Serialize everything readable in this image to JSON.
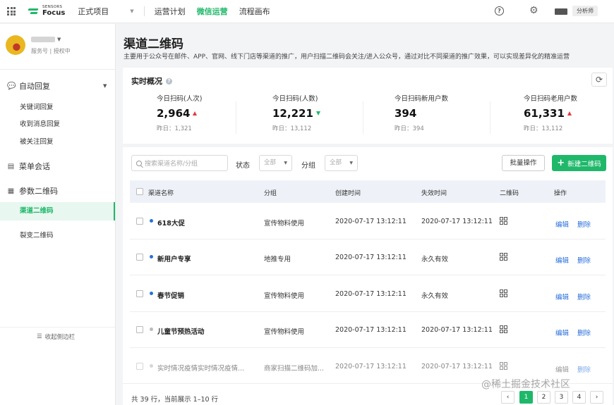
{
  "topbar": {
    "brand_top": "SENSORS",
    "brand_bottom": "Focus",
    "project": "正式项目",
    "nav": [
      "运营计划",
      "微信运营",
      "流程画布"
    ],
    "role": "分析师"
  },
  "sidebar": {
    "account_sub": "服务号 | 授权中",
    "groups": [
      {
        "label": "自动回复",
        "icon": "chat-bubble-icon",
        "items": [
          "关键词回复",
          "收到消息回复",
          "被关注回复"
        ]
      },
      {
        "label": "菜单会话",
        "icon": "menu-chat-icon"
      },
      {
        "label": "参数二维码",
        "icon": "qrcode-icon",
        "items": [
          "渠道二维码",
          "裂变二维码"
        ]
      }
    ],
    "collapse_label": "收起侧边栏"
  },
  "page": {
    "title": "渠道二维码",
    "description": "主要用于公众号在邮件、APP、官网、线下门店等渠道的推广，用户扫描二维码会关注/进入公众号，通过对比不同渠道的推广效果，可以实现差异化的精准运营"
  },
  "overview": {
    "title": "实时概况",
    "metrics": [
      {
        "label": "今日扫码(人次)",
        "value": "2,964",
        "trend": "up",
        "prev": "昨日：1,321"
      },
      {
        "label": "今日扫码(人数)",
        "value": "12,221",
        "trend": "down",
        "prev": "昨日：13,112"
      },
      {
        "label": "今日扫码新用户数",
        "value": "394",
        "trend": "none",
        "prev": "昨日：394"
      },
      {
        "label": "今日扫码老用户数",
        "value": "61,331",
        "trend": "up",
        "prev": "昨日：13,112"
      }
    ]
  },
  "filters": {
    "search_placeholder": "搜索渠道名称/分组",
    "status_label": "状态",
    "status_value": "全部",
    "group_label": "分组",
    "group_value": "全部",
    "batch_label": "批量操作",
    "new_label": "新建二维码"
  },
  "table": {
    "headers": [
      "渠道名称",
      "分组",
      "创建时间",
      "失效时间",
      "二维码",
      "操作"
    ],
    "rows": [
      {
        "name": "618大促",
        "group": "宣传物料使用",
        "created": "2020-07-17 13:12:11",
        "expires": "2020-07-17 13:12:11",
        "active": true
      },
      {
        "name": "新用户专享",
        "group": "地推专用",
        "created": "2020-07-17 13:12:11",
        "expires": "永久有效",
        "active": true
      },
      {
        "name": "春节促销",
        "group": "宣传物料使用",
        "created": "2020-07-17 13:12:11",
        "expires": "永久有效",
        "active": true
      },
      {
        "name": "儿童节预热活动",
        "group": "宣传物料使用",
        "created": "2020-07-17 13:12:11",
        "expires": "2020-07-17 13:12:11",
        "active": false
      },
      {
        "name": "实时情况疫情实时情况疫情...",
        "group": "商家扫描二维码加...",
        "created": "2020-07-17 13:12:11",
        "expires": "2020-07-17 13:12:11",
        "active": false
      }
    ],
    "edit_label": "编辑",
    "delete_label": "删除"
  },
  "pagination": {
    "summary": "共 39 行，当前展示 1–10 行",
    "pages": [
      "1",
      "2",
      "3",
      "4"
    ],
    "current": "1"
  },
  "watermark": "@稀土掘金技术社区",
  "colors": {
    "accent": "#1fb86a",
    "link": "#2a6fdb",
    "up": "#e0393e"
  }
}
